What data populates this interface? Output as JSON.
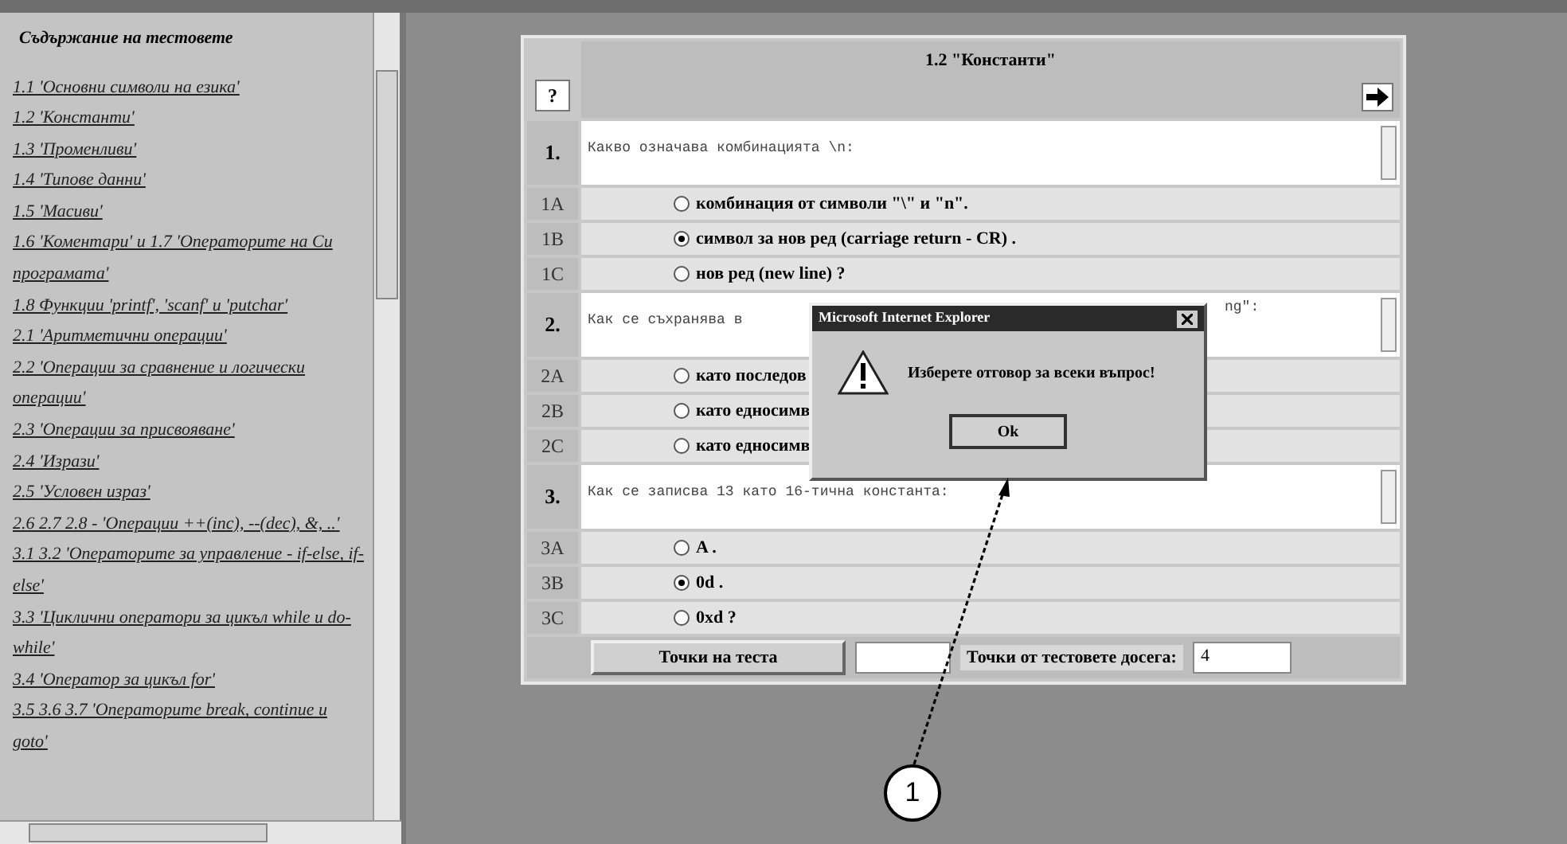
{
  "sidebar": {
    "title": "Съдържание на тестовете",
    "links": [
      "1.1 'Основни символи на езика'",
      "1.2 'Константи'",
      "1.3 'Променливи'",
      "1.4 'Типове данни'",
      "1.5 'Масиви'",
      "1.6 'Коментари' и 1.7 'Операторите на Си програмата'",
      "1.8 Функции 'printf', 'scanf' и 'putchar'",
      "2.1 'Аритметични операции'",
      "2.2 'Операции за сравнение и логически операции'",
      "2.3 'Операции за присвояване'",
      "2.4 'Изрази'",
      "2.5 'Условен израз'",
      "2.6 2.7 2.8 - 'Операции ++(inc), --(dec), &, ..'",
      "3.1 3.2 'Операторите за управление - if-else, if-else'",
      "3.3 'Циклични оператори за цикъл while и do-while'",
      "3.4 'Оператор за цикъл for'",
      "3.5 3.6 3.7 'Операторите break, continue и goto'"
    ]
  },
  "test": {
    "title": "1.2 \"Константи\"",
    "help_button": "?",
    "questions": [
      {
        "number": "1.",
        "text": "Какво означава комбинацията \\n:",
        "options": [
          {
            "label": "1A",
            "text": "комбинация от символи \"\\\" и \"n\".",
            "selected": false
          },
          {
            "label": "1B",
            "text": "символ за нов ред (carriage return - CR) .",
            "selected": true
          },
          {
            "label": "1C",
            "text": "нов ред (new line) ?",
            "selected": false
          }
        ]
      },
      {
        "number": "2.",
        "text": "Как се съхранява в",
        "text_tail": "ng\":",
        "options": [
          {
            "label": "2A",
            "text": "като последов",
            "selected": false
          },
          {
            "label": "2B",
            "text": "като едносимв",
            "selected": false
          },
          {
            "label": "2C",
            "text": "като едносимв",
            "selected": false
          }
        ]
      },
      {
        "number": "3.",
        "text": "Как се записва 13 като 16-тична константа:",
        "options": [
          {
            "label": "3A",
            "text": "A .",
            "selected": false
          },
          {
            "label": "3B",
            "text": "0d .",
            "selected": true
          },
          {
            "label": "3C",
            "text": "0xd ?",
            "selected": false
          }
        ]
      }
    ]
  },
  "footer": {
    "button": "Точки на теста",
    "total_label": "Точки от тестовете досега:",
    "total_value": "4"
  },
  "dialog": {
    "title": "Microsoft Internet Explorer",
    "message": "Изберете отговор за всеки въпрос!",
    "button": "Ok"
  },
  "callout": {
    "label": "1"
  }
}
